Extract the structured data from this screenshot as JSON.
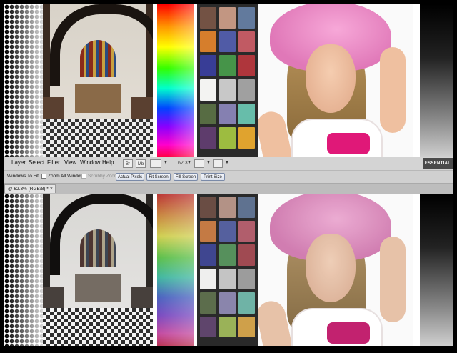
{
  "menubar": {
    "items": [
      "Layer",
      "Select",
      "Filter",
      "View",
      "Window",
      "Help"
    ],
    "icon_labels": [
      "Br",
      "Mb"
    ],
    "zoom_value": "62.3",
    "workspace_button": "ESSENTIAL"
  },
  "options_bar": {
    "windows_to_fit": "Windows To Fit",
    "zoom_all_windows": "Zoom All Windows",
    "scrubby_zoom": "Scrubby Zoom",
    "actual_pixels": "Actual Pixels",
    "fit_screen": "Fit Screen",
    "fill_screen": "Fill Screen",
    "print_size": "Print Size"
  },
  "document_tab": {
    "title": "@ 62.3% (RGB/8) *",
    "close": "×"
  },
  "checker_top": [
    "#735244",
    "#c29682",
    "#627a9d",
    "#d67e2c",
    "#505ba6",
    "#c15a63",
    "#383d96",
    "#469449",
    "#af363c",
    "#f3f3f2",
    "#c8c8c8",
    "#a0a0a0",
    "#576c43",
    "#8580b1",
    "#67bdaa",
    "#5e3c6c",
    "#9dbc40",
    "#e0a32e",
    "#e7c71f",
    "#bb5695",
    "#0885a1",
    "#7a7a79",
    "#555555",
    "#343434"
  ],
  "checker_bottom": [
    "#6a4d44",
    "#b39286",
    "#5f7290",
    "#c47a44",
    "#55609e",
    "#b15e6c",
    "#3f4690",
    "#56905c",
    "#a04a52",
    "#efefee",
    "#c4c4c4",
    "#9c9c9c",
    "#5c6d4c",
    "#8a85ac",
    "#6fb3a6",
    "#5f456c",
    "#9ab258",
    "#cfa04a",
    "#d6bf44",
    "#ad5e92",
    "#2c7d94",
    "#777776",
    "#545454",
    "#353535"
  ]
}
